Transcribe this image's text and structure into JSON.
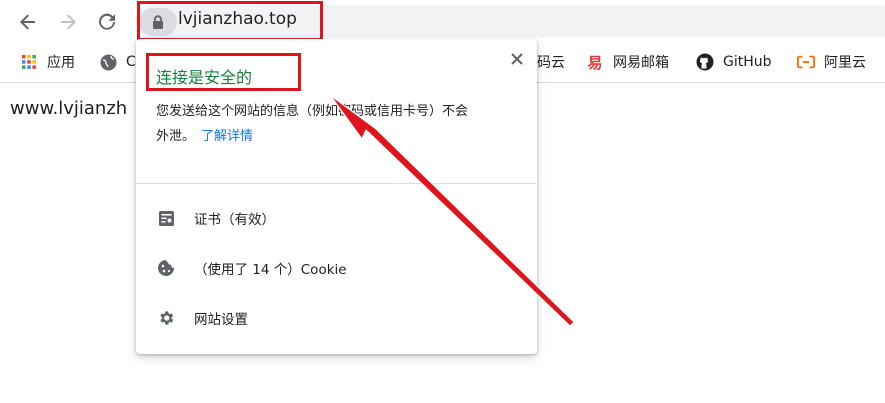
{
  "toolbar": {
    "url": "lvjianzhao.top"
  },
  "bookmarks": [
    {
      "icon": "apps-grid-icon",
      "label": "应用"
    },
    {
      "icon": "globe-icon",
      "label": "C"
    },
    {
      "icon": "bookmark-partial",
      "label": "码云"
    },
    {
      "icon": "netease-icon",
      "label": "网易邮箱"
    },
    {
      "icon": "github-icon",
      "label": "GitHub"
    },
    {
      "icon": "aliyun-icon",
      "label": "阿里云"
    }
  ],
  "page": {
    "text": "www.lvjianzh"
  },
  "popup": {
    "title": "连接是安全的",
    "desc_line1": "您发送给这个网站的信息（例如密码或信用卡号）不会",
    "desc_line2": "外泄。",
    "learn_more": "了解详情",
    "rows": [
      {
        "icon": "certificate-icon",
        "label": "证书（有效）"
      },
      {
        "icon": "cookie-icon",
        "label": "（使用了 14 个）Cookie"
      },
      {
        "icon": "gear-icon",
        "label": "网站设置"
      }
    ]
  },
  "colors": {
    "highlight": "#e0141c",
    "secure_green": "#188038",
    "link_blue": "#1a73e8"
  }
}
